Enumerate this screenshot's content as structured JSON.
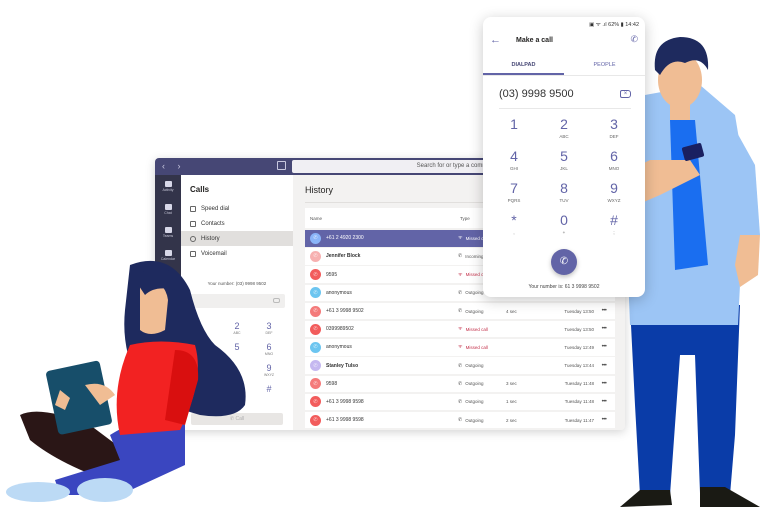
{
  "desktop": {
    "search_placeholder": "Search for or type a command",
    "rail": [
      {
        "label": "Activity",
        "icon": "bell-icon"
      },
      {
        "label": "Chat",
        "icon": "chat-icon"
      },
      {
        "label": "Teams",
        "icon": "teams-icon"
      },
      {
        "label": "Calendar",
        "icon": "calendar-icon"
      }
    ],
    "calls_title": "Calls",
    "calls_nav": [
      {
        "label": "Speed dial",
        "icon": "phone-icon"
      },
      {
        "label": "Contacts",
        "icon": "contacts-icon"
      },
      {
        "label": "History",
        "icon": "clock-icon",
        "active": true
      },
      {
        "label": "Voicemail",
        "icon": "voicemail-icon"
      }
    ],
    "your_number": "Your number: (03) 9998 9502",
    "dialpad": [
      {
        "digit": "2",
        "letters": "ABC"
      },
      {
        "digit": "3",
        "letters": "DEF"
      },
      {
        "digit": "5",
        "letters": ""
      },
      {
        "digit": "6",
        "letters": "MNO"
      },
      {
        "digit": "9",
        "letters": "WXYZ"
      },
      {
        "digit": "#",
        "letters": ""
      }
    ],
    "call_button": "Call",
    "history": {
      "title": "History",
      "columns": [
        "Name",
        "Type"
      ],
      "rows": [
        {
          "name": "+61 2 4920 2300",
          "type": "Missed call",
          "duration": "",
          "time": "",
          "color": "#8ab4f8",
          "missed": true,
          "selected": true
        },
        {
          "name": "Jennifer Block",
          "type": "Incoming",
          "duration": "",
          "time": "",
          "color": "#f7b0b0",
          "bold": true
        },
        {
          "name": "9595",
          "type": "Missed call",
          "duration": "",
          "time": "",
          "color": "#f25c5c",
          "missed": true
        },
        {
          "name": "anonymous",
          "type": "Outgoing",
          "duration": "",
          "time": "",
          "color": "#6cc5f0"
        },
        {
          "name": "+61 3 9998 9502",
          "type": "Outgoing",
          "duration": "4 sec",
          "time": "Tuesday 13:50",
          "color": "#f47a7a"
        },
        {
          "name": "0399989502",
          "type": "Missed call",
          "duration": "",
          "time": "Tuesday 13:50",
          "color": "#f25c5c",
          "missed": true
        },
        {
          "name": "anonymous",
          "type": "Missed call",
          "duration": "",
          "time": "Tuesday 12:49",
          "color": "#6cc5f0",
          "missed": true
        },
        {
          "name": "Stanley Tulso",
          "type": "Outgoing",
          "duration": "",
          "time": "Tuesday 13:44",
          "color": "#c5b8f0",
          "bold": true
        },
        {
          "name": "9598",
          "type": "Outgoing",
          "duration": "3 sec",
          "time": "Tuesday 11:48",
          "color": "#f47a7a"
        },
        {
          "name": "+61 3 9998 9598",
          "type": "Outgoing",
          "duration": "1 sec",
          "time": "Tuesday 11:48",
          "color": "#f25c5c"
        },
        {
          "name": "+61 3 9998 9598",
          "type": "Outgoing",
          "duration": "2 sec",
          "time": "Tuesday 11:47",
          "color": "#f25c5c"
        }
      ]
    }
  },
  "phone": {
    "status": "▣ ᯤ .ıl 62% ▮ 14:42",
    "title": "Make a call",
    "tabs": [
      {
        "label": "DIALPAD",
        "active": true
      },
      {
        "label": "PEOPLE",
        "active": false
      }
    ],
    "number": "(03) 9998 9500",
    "keys": [
      {
        "digit": "1",
        "letters": ""
      },
      {
        "digit": "2",
        "letters": "ABC"
      },
      {
        "digit": "3",
        "letters": "DEF"
      },
      {
        "digit": "4",
        "letters": "GHI"
      },
      {
        "digit": "5",
        "letters": "JKL"
      },
      {
        "digit": "6",
        "letters": "MNO"
      },
      {
        "digit": "7",
        "letters": "PQRS"
      },
      {
        "digit": "8",
        "letters": "TUV"
      },
      {
        "digit": "9",
        "letters": "WXYZ"
      },
      {
        "digit": "*",
        "letters": ","
      },
      {
        "digit": "0",
        "letters": "+"
      },
      {
        "digit": "#",
        "letters": ";"
      }
    ],
    "your_number": "Your number is: 61 3 9998 9502"
  },
  "colors": {
    "accent": "#6264a7",
    "titlebar": "#464775",
    "rail": "#33344a",
    "missed": "#c4314b"
  }
}
